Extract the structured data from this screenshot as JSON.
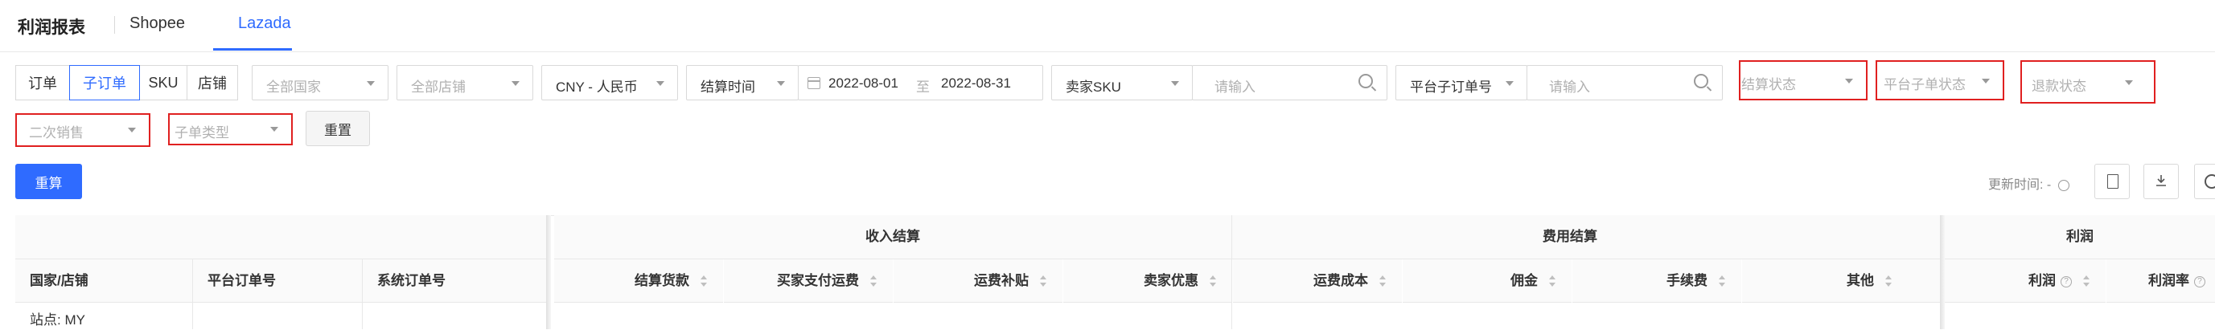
{
  "tabs": {
    "title": "利润报表",
    "items": [
      {
        "label": "Shopee",
        "active": false
      },
      {
        "label": "Lazada",
        "active": true
      }
    ]
  },
  "filters": {
    "order_level": [
      "订单",
      "子订单",
      "SKU",
      "店铺"
    ],
    "country_placeholder": "全部国家",
    "store_placeholder": "全部店铺",
    "currency": "CNY - 人民币",
    "time_type": "结算时间",
    "date_from": "2022-08-01",
    "date_sep": "至",
    "date_to": "2022-08-31",
    "sku_type": "卖家SKU",
    "sku_placeholder": "请输入",
    "order_no_type": "平台子订单号",
    "order_no_placeholder": "请输入",
    "settle_status_placeholder": "结算状态",
    "sub_order_status_placeholder": "平台子单状态",
    "refund_status_placeholder": "退款状态",
    "resale_placeholder": "二次销售",
    "sub_order_type_placeholder": "子单类型",
    "reset_label": "重置"
  },
  "actions": {
    "recalc_label": "重算",
    "update_time_label": "更新时间: -"
  },
  "table": {
    "groups": [
      "收入结算",
      "费用结算",
      "利润"
    ],
    "columns": {
      "country_store": "国家/店铺",
      "platform_order": "平台订单号",
      "system_order": "系统订单号",
      "settle_amount": "结算货款",
      "buyer_shipping": "买家支付运费",
      "shipping_subsidy": "运费补贴",
      "seller_discount": "卖家优惠",
      "shipping_cost": "运费成本",
      "commission": "佣金",
      "fee": "手续费",
      "other": "其他",
      "profit": "利润",
      "profit_rate": "利润率"
    },
    "first_row": {
      "site": "站点: MY"
    }
  }
}
